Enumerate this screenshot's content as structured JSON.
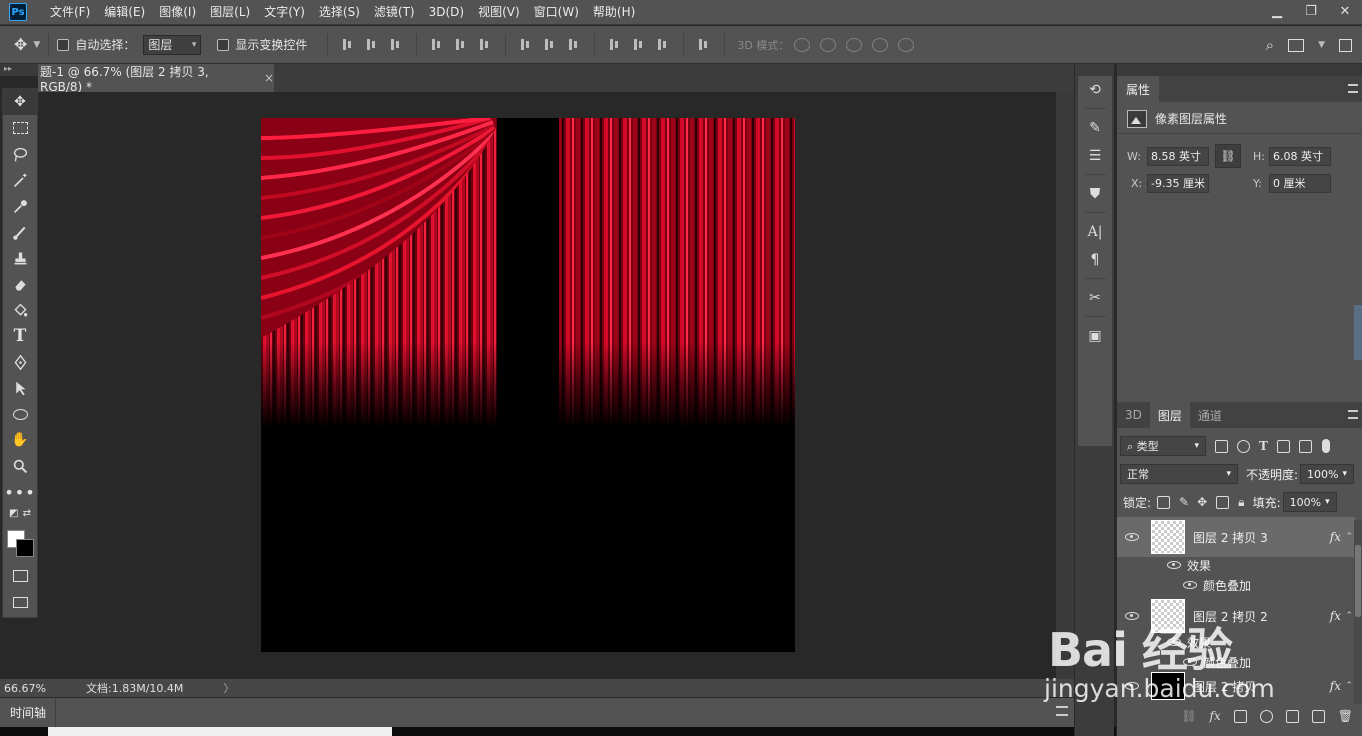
{
  "app": {
    "logo": "Ps",
    "menu": [
      "文件(F)",
      "编辑(E)",
      "图像(I)",
      "图层(L)",
      "文字(Y)",
      "选择(S)",
      "滤镜(T)",
      "3D(D)",
      "视图(V)",
      "窗口(W)",
      "帮助(H)"
    ],
    "window_controls": [
      "minimize",
      "restore",
      "close"
    ]
  },
  "options_bar": {
    "auto_select_label": "自动选择：",
    "auto_select_value": "图层",
    "show_transform_label": "显示变换控件",
    "mode3d_label": "3D 模式："
  },
  "document": {
    "tab_title": "题-1 @ 66.7% (图层 2 拷贝 3, RGB/8) *",
    "close_glyph": "×"
  },
  "status": {
    "zoom": "66.67%",
    "doc_info": "文档:1.83M/10.4M",
    "arrow": "〉"
  },
  "timeline": {
    "label": "时间轴"
  },
  "properties": {
    "tab": "属性",
    "header": "像素图层属性",
    "w_label": "W:",
    "w_value": "8.58 英寸",
    "h_label": "H:",
    "h_value": "6.08 英寸",
    "x_label": "X:",
    "x_value": "-9.35 厘米",
    "y_label": "Y:",
    "y_value": "0 厘米"
  },
  "layers_panel": {
    "tabs": [
      "3D",
      "图层",
      "通道"
    ],
    "active_tab": "图层",
    "filter_kind": "类型",
    "blend_mode": "正常",
    "opacity_label": "不透明度:",
    "opacity_value": "100%",
    "lock_label": "锁定:",
    "fill_label": "填充:",
    "fill_value": "100%",
    "layers": [
      {
        "name": "图层 2 拷贝 3",
        "selected": true,
        "effects_label": "效果",
        "effect": "颜色叠加"
      },
      {
        "name": "图层 2 拷贝 2",
        "selected": false,
        "effects_label": "效果",
        "effect": "颜色叠加"
      },
      {
        "name": "图层 2 拷贝",
        "selected": false
      }
    ],
    "fx_label": "fx"
  },
  "watermark": {
    "brand": "Bai 经验",
    "url": "jingyan.baidu.com"
  },
  "colors": {
    "curtain_red": "#e0102e",
    "panel_bg": "#535353",
    "canvas_bg": "#000000"
  }
}
